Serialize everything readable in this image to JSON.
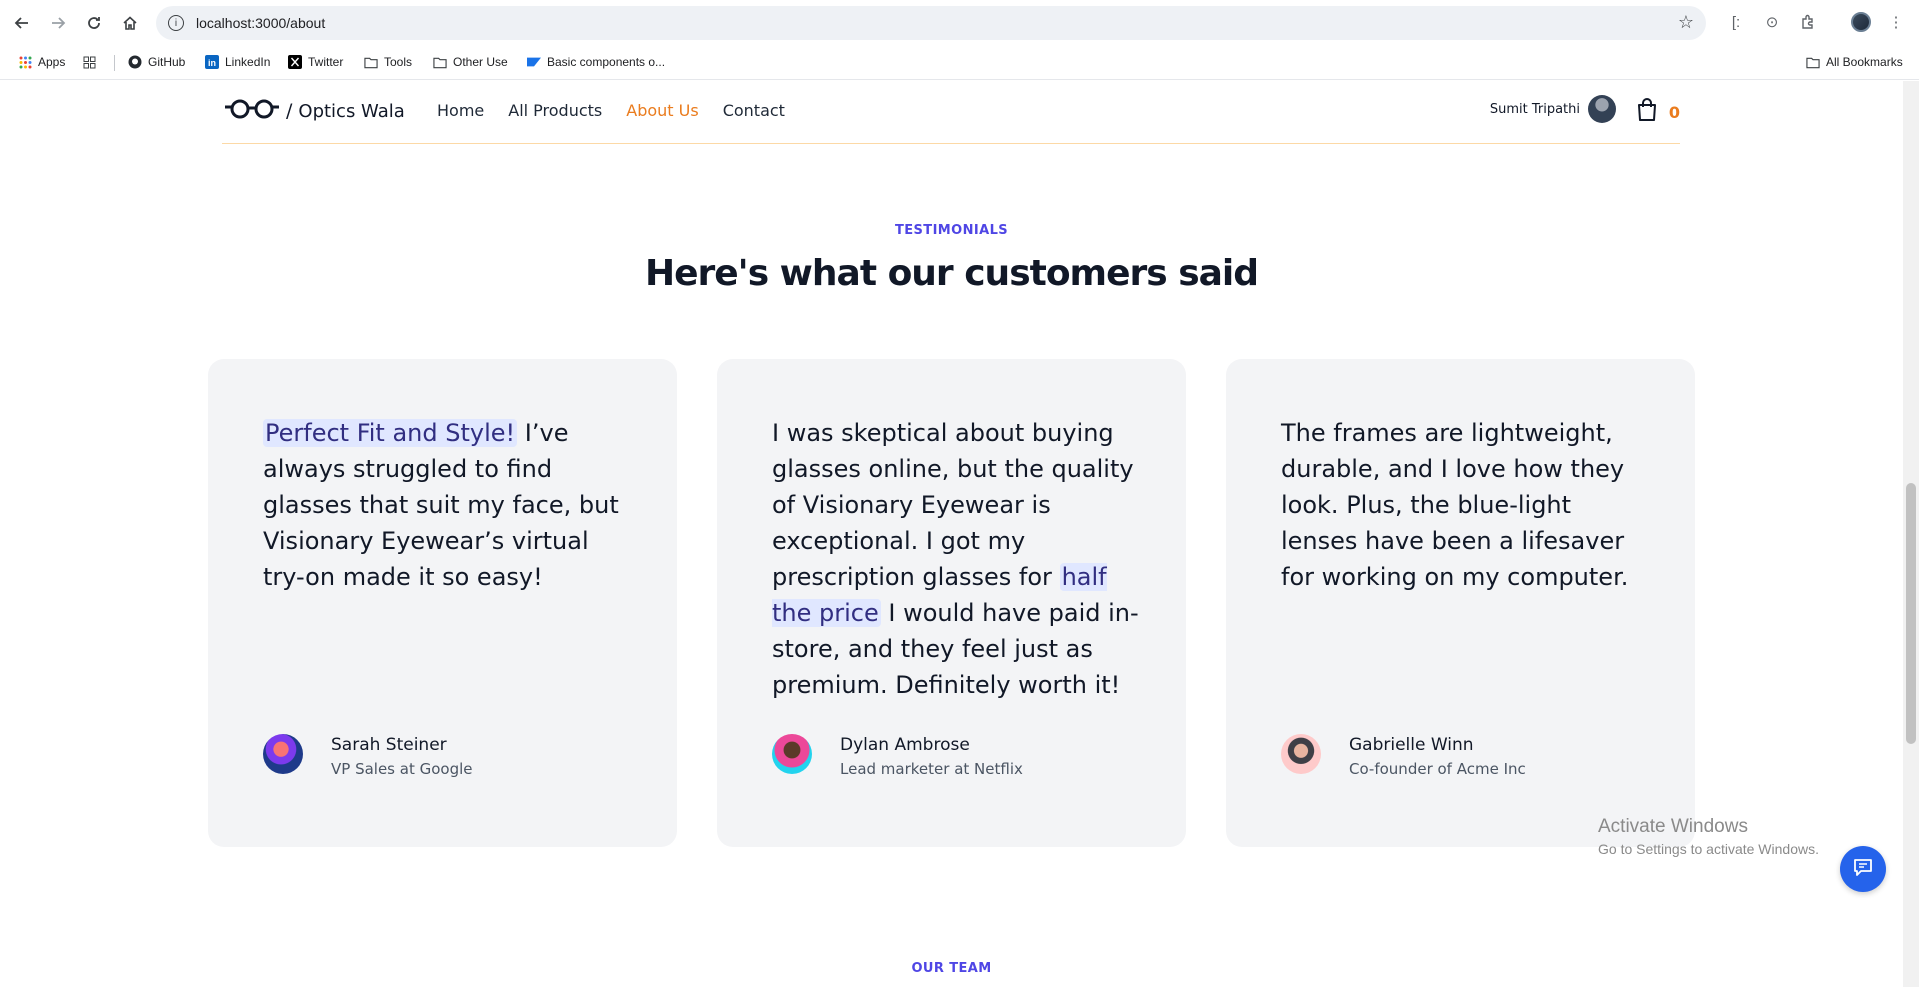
{
  "browser": {
    "url": "localhost:3000/about",
    "bookmarks": [
      "Apps",
      "GitHub",
      "LinkedIn",
      "Twitter",
      "Tools",
      "Other Use",
      "Basic components o..."
    ],
    "all_bookmarks": "All Bookmarks"
  },
  "header": {
    "brand": "Optics Wala",
    "slash": "/",
    "nav": [
      "Home",
      "All Products",
      "About Us",
      "Contact"
    ],
    "active_nav": "About Us",
    "user_name": "Sumit Tripathi",
    "cart_count": "0"
  },
  "testimonials": {
    "tag": "TESTIMONIALS",
    "title": "Here's what our customers said",
    "cards": [
      {
        "quote_highlight": "Perfect Fit and Style!",
        "quote_rest": " I’ve always struggled to find glasses that suit my face, but Visionary Eyewear’s virtual try-on made it so easy!",
        "name": "Sarah Steiner",
        "role": "VP Sales at Google"
      },
      {
        "quote_before": "I was skeptical about buying glasses online, but the quality of Visionary Eyewear is exceptional. I got my prescription glasses for ",
        "quote_highlight": "half the price",
        "quote_after": " I would have paid in-store, and they feel just as premium. Definitely worth it!",
        "name": "Dylan Ambrose",
        "role": "Lead marketer at Netflix"
      },
      {
        "quote": "The frames are lightweight, durable, and I love how they look. Plus, the blue-light lenses have been a lifesaver for working on my computer.",
        "name": "Gabrielle Winn",
        "role": "Co-founder of Acme Inc"
      }
    ]
  },
  "team": {
    "tag": "OUR TEAM"
  },
  "watermark": {
    "line1": "Activate Windows",
    "line2": "Go to Settings to activate Windows."
  },
  "colors": {
    "accent": "#ea7c1e",
    "indigo": "#4f46e5",
    "card_bg": "#f3f4f6",
    "highlight_bg": "#e0e7ff"
  },
  "icons": [
    "back-icon",
    "forward-icon",
    "reload-icon",
    "home-icon",
    "info-icon",
    "star-icon",
    "extensions-icon",
    "glasses-logo-icon",
    "shopping-bag-icon",
    "chat-icon"
  ]
}
